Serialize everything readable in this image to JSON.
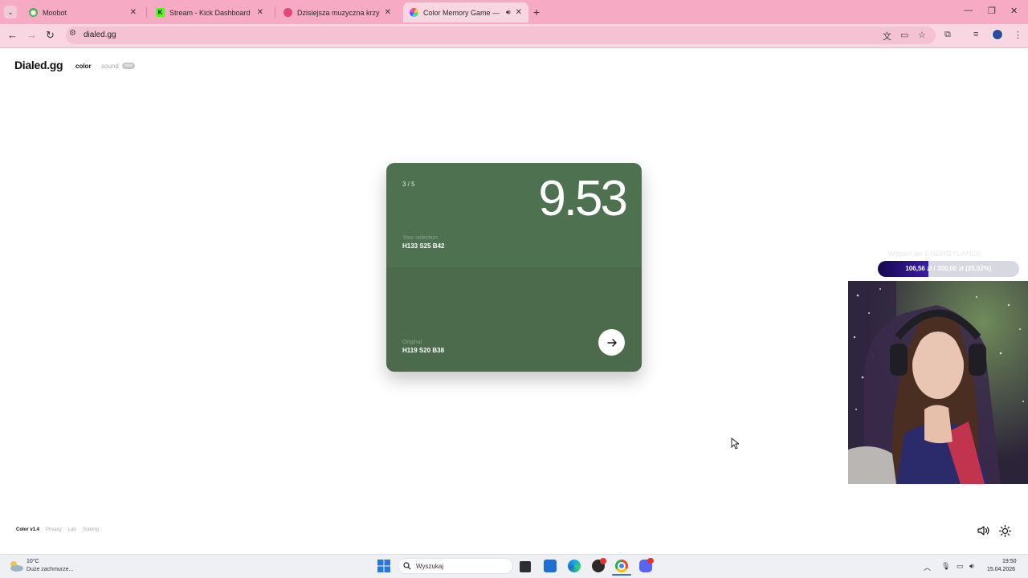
{
  "browser": {
    "tabs": [
      {
        "title": "Moobot",
        "favicon": "moobot-icon",
        "color": "#4caf50"
      },
      {
        "title": "Stream - Kick Dashboard",
        "favicon": "kick-icon",
        "color": "#1a1a1a"
      },
      {
        "title": "Dzisiejsza muzyczna krzyżówka",
        "favicon": "puzzle-icon",
        "color": "#e0457b"
      },
      {
        "title": "Color Memory Game — Ho",
        "favicon": "color-wheel-icon",
        "color": "#e04a8c"
      }
    ],
    "new_tab_label": "+",
    "url": "dialed.gg"
  },
  "site": {
    "logo": "Dialed.gg",
    "nav_color": "color",
    "nav_sound": "sound",
    "nav_sound_badge": "new"
  },
  "game": {
    "round": "3 / 5",
    "score": "9.53",
    "selection_label": "Your selection",
    "selection_value": "H133 S25 B42",
    "original_label": "Original",
    "original_value": "H119 S20 B38",
    "selection_color": "#4e7150",
    "original_color": "#4b6b4c"
  },
  "footer": {
    "version": "Color v1.4",
    "links": [
      "Privacy",
      "Lab",
      "Scoring"
    ]
  },
  "overlay": {
    "donation_title": "Wypad do ENERGYLANDII",
    "donation_text": "106,56 zł / 300,00 zł (35,52%)",
    "donation_progress": 0.3552
  },
  "taskbar": {
    "weather_temp": "10°C",
    "weather_desc": "Duże zachmurze...",
    "search_placeholder": "Wyszukaj",
    "time": "19:50",
    "date": "15.04.2026"
  }
}
